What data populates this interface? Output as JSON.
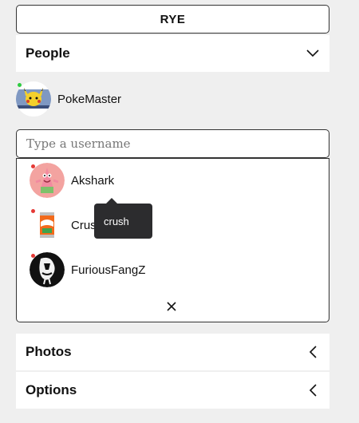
{
  "room": {
    "name": "RYE"
  },
  "sections": {
    "people": "People",
    "photos": "Photos",
    "options": "Options"
  },
  "me": {
    "username": "PokeMaster",
    "status_color": "#2ecc40"
  },
  "search": {
    "placeholder": "Type a username",
    "value": ""
  },
  "suggestions": [
    {
      "username": "Akshark",
      "status_color": "#e53935",
      "avatar": "patrick-avatar"
    },
    {
      "username": "Crush",
      "status_color": "#e53935",
      "avatar": "soda-can-avatar"
    },
    {
      "username": "FuriousFangZ",
      "status_color": "#e53935",
      "avatar": "bw-character-avatar"
    }
  ],
  "tooltip": {
    "text": "crush"
  },
  "icons": {
    "people_toggle": "chevron-down-icon",
    "photos_toggle": "chevron-left-icon",
    "options_toggle": "chevron-left-icon",
    "close_dropdown": "close-icon"
  }
}
